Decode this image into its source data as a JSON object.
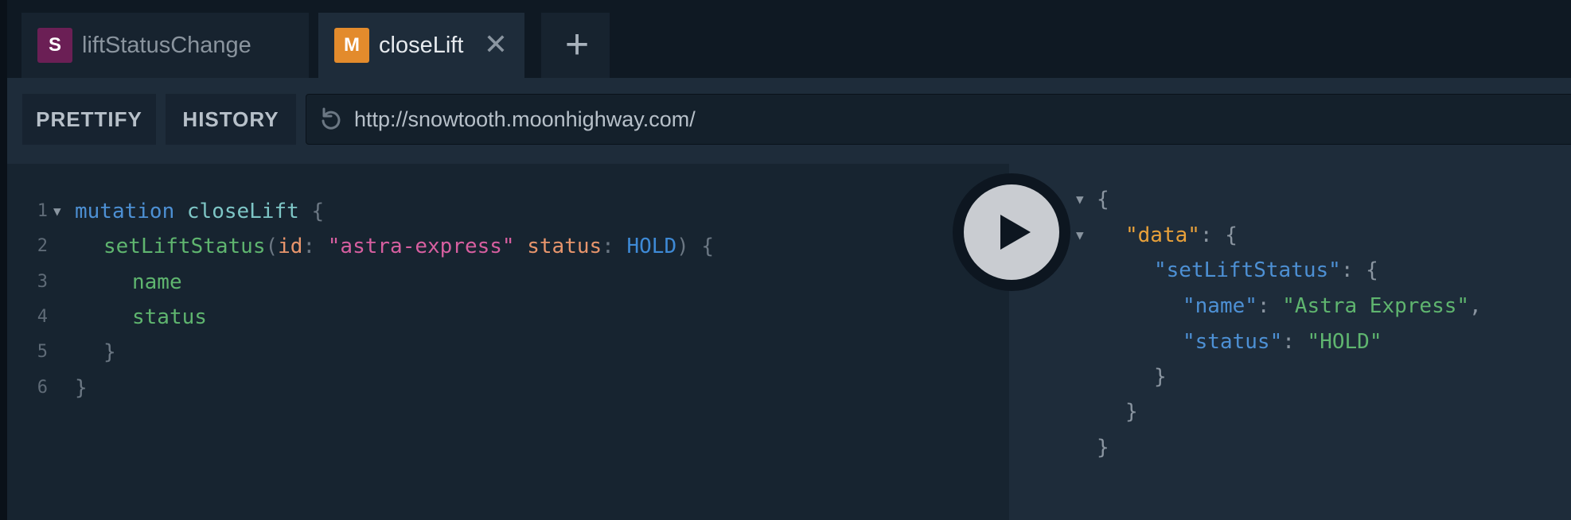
{
  "tabs": [
    {
      "badge": "S",
      "label": "liftStatusChange",
      "badge_color": "#6b1f55"
    },
    {
      "badge": "M",
      "label": "closeLift",
      "badge_color": "#e38b2c",
      "close": "✕"
    }
  ],
  "add_tab": "+",
  "toolbar": {
    "prettify": "PRETTIFY",
    "history": "HISTORY",
    "url": "http://snowtooth.moonhighway.com/"
  },
  "editor": {
    "line_numbers": [
      "1",
      "2",
      "3",
      "4",
      "5",
      "6"
    ],
    "l1": {
      "keyword": "mutation",
      "name": "closeLift",
      "brace": "{"
    },
    "l2": {
      "field": "setLiftStatus",
      "paren_open": "(",
      "arg1": "id",
      "colon1": ":",
      "value1": "\"astra-express\"",
      "arg2": "status",
      "colon2": ":",
      "value2": "HOLD",
      "paren_close": ")",
      "brace": "{"
    },
    "l3": {
      "field": "name"
    },
    "l4": {
      "field": "status"
    },
    "l5": {
      "brace": "}"
    },
    "l6": {
      "brace": "}"
    }
  },
  "result": {
    "r1": "{",
    "r2_key": "\"data\"",
    "r2_colon": ":",
    "r2_brace": "{",
    "r3_key": "\"setLiftStatus\"",
    "r3_colon": ":",
    "r3_brace": "{",
    "r4_key": "\"name\"",
    "r4_colon": ":",
    "r4_value": "\"Astra Express\"",
    "r4_comma": ",",
    "r5_key": "\"status\"",
    "r5_colon": ":",
    "r5_value": "\"HOLD\"",
    "r6": "}",
    "r7": "}",
    "r8": "}"
  },
  "colors": {
    "tab_bar": "#0f1923",
    "toolbar": "#1e2c3a",
    "editor_bg": "#172430",
    "result_bg": "#1e2c3a",
    "run_button": "#c9ccd1"
  }
}
